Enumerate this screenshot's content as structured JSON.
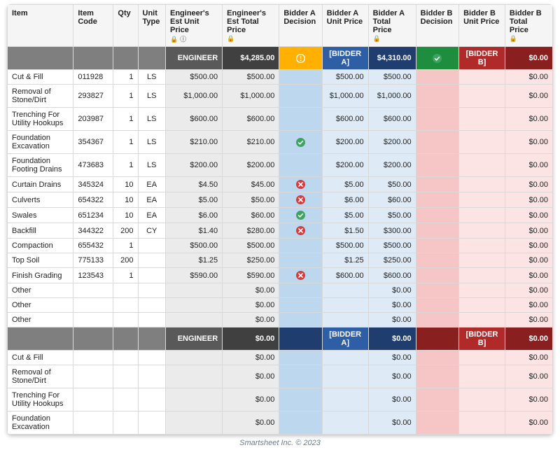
{
  "headers": {
    "item": "Item",
    "code": "Item Code",
    "qty": "Qty",
    "unit": "Unit Type",
    "eup": "Engineer's Est Unit Price",
    "etp": "Engineer's Est Total Price",
    "bad": "Bidder A Decision",
    "baup": "Bidder A Unit Price",
    "batp": "Bidder A Total Price",
    "bbd": "Bidder B Decision",
    "bbup": "Bidder B Unit Price",
    "bbtp": "Bidder B Total Price"
  },
  "summary1": {
    "eng_label": "ENGINEER",
    "eng_total": "$4,285.00",
    "ba_label": "[BIDDER A]",
    "ba_total": "$4,310.00",
    "ba_status": "warn",
    "bb_label": "[BIDDER B]",
    "bb_total": "$0.00",
    "bb_status": "ok"
  },
  "summary2": {
    "eng_label": "ENGINEER",
    "eng_total": "$0.00",
    "ba_label": "[BIDDER A]",
    "ba_total": "$0.00",
    "bb_label": "[BIDDER B]",
    "bb_total": "$0.00"
  },
  "rows1": [
    {
      "item": "Cut & Fill",
      "code": "011928",
      "qty": "1",
      "ut": "LS",
      "eup": "$500.00",
      "etp": "$500.00",
      "bad": "",
      "baup": "$500.00",
      "batp": "$500.00",
      "bbtp": "$0.00"
    },
    {
      "item": "Removal of Stone/Dirt",
      "code": "293827",
      "qty": "1",
      "ut": "LS",
      "eup": "$1,000.00",
      "etp": "$1,000.00",
      "bad": "",
      "baup": "$1,000.00",
      "batp": "$1,000.00",
      "bbtp": "$0.00"
    },
    {
      "item": "Trenching For Utility Hookups",
      "code": "203987",
      "qty": "1",
      "ut": "LS",
      "eup": "$600.00",
      "etp": "$600.00",
      "bad": "",
      "baup": "$600.00",
      "batp": "$600.00",
      "bbtp": "$0.00"
    },
    {
      "item": "Foundation Excavation",
      "code": "354367",
      "qty": "1",
      "ut": "LS",
      "eup": "$210.00",
      "etp": "$210.00",
      "bad": "ok",
      "baup": "$200.00",
      "batp": "$200.00",
      "bbtp": "$0.00"
    },
    {
      "item": "Foundation Footing Drains",
      "code": "473683",
      "qty": "1",
      "ut": "LS",
      "eup": "$200.00",
      "etp": "$200.00",
      "bad": "",
      "baup": "$200.00",
      "batp": "$200.00",
      "bbtp": "$0.00"
    },
    {
      "item": "Curtain Drains",
      "code": "345324",
      "qty": "10",
      "ut": "EA",
      "eup": "$4.50",
      "etp": "$45.00",
      "bad": "no",
      "baup": "$5.00",
      "batp": "$50.00",
      "bbtp": "$0.00"
    },
    {
      "item": "Culverts",
      "code": "654322",
      "qty": "10",
      "ut": "EA",
      "eup": "$5.00",
      "etp": "$50.00",
      "bad": "no",
      "baup": "$6.00",
      "batp": "$60.00",
      "bbtp": "$0.00"
    },
    {
      "item": "Swales",
      "code": "651234",
      "qty": "10",
      "ut": "EA",
      "eup": "$6.00",
      "etp": "$60.00",
      "bad": "ok",
      "baup": "$5.00",
      "batp": "$50.00",
      "bbtp": "$0.00"
    },
    {
      "item": "Backfill",
      "code": "344322",
      "qty": "200",
      "ut": "CY",
      "eup": "$1.40",
      "etp": "$280.00",
      "bad": "no",
      "baup": "$1.50",
      "batp": "$300.00",
      "bbtp": "$0.00"
    },
    {
      "item": "Compaction",
      "code": "655432",
      "qty": "1",
      "ut": "",
      "eup": "$500.00",
      "etp": "$500.00",
      "bad": "",
      "baup": "$500.00",
      "batp": "$500.00",
      "bbtp": "$0.00"
    },
    {
      "item": "Top Soil",
      "code": "775133",
      "qty": "200",
      "ut": "",
      "eup": "$1.25",
      "etp": "$250.00",
      "bad": "",
      "baup": "$1.25",
      "batp": "$250.00",
      "bbtp": "$0.00"
    },
    {
      "item": "Finish Grading",
      "code": "123543",
      "qty": "1",
      "ut": "",
      "eup": "$590.00",
      "etp": "$590.00",
      "bad": "no",
      "baup": "$600.00",
      "batp": "$600.00",
      "bbtp": "$0.00"
    },
    {
      "item": "Other",
      "code": "",
      "qty": "",
      "ut": "",
      "eup": "",
      "etp": "$0.00",
      "bad": "",
      "baup": "",
      "batp": "$0.00",
      "bbtp": "$0.00"
    },
    {
      "item": "Other",
      "code": "",
      "qty": "",
      "ut": "",
      "eup": "",
      "etp": "$0.00",
      "bad": "",
      "baup": "",
      "batp": "$0.00",
      "bbtp": "$0.00"
    },
    {
      "item": "Other",
      "code": "",
      "qty": "",
      "ut": "",
      "eup": "",
      "etp": "$0.00",
      "bad": "",
      "baup": "",
      "batp": "$0.00",
      "bbtp": "$0.00"
    }
  ],
  "rows2": [
    {
      "item": "Cut & Fill",
      "etp": "$0.00",
      "batp": "$0.00",
      "bbtp": "$0.00"
    },
    {
      "item": "Removal of Stone/Dirt",
      "etp": "$0.00",
      "batp": "$0.00",
      "bbtp": "$0.00"
    },
    {
      "item": "Trenching For Utility Hookups",
      "etp": "$0.00",
      "batp": "$0.00",
      "bbtp": "$0.00"
    },
    {
      "item": "Foundation Excavation",
      "etp": "$0.00",
      "batp": "$0.00",
      "bbtp": "$0.00"
    }
  ],
  "footer": "Smartsheet Inc. © 2023"
}
